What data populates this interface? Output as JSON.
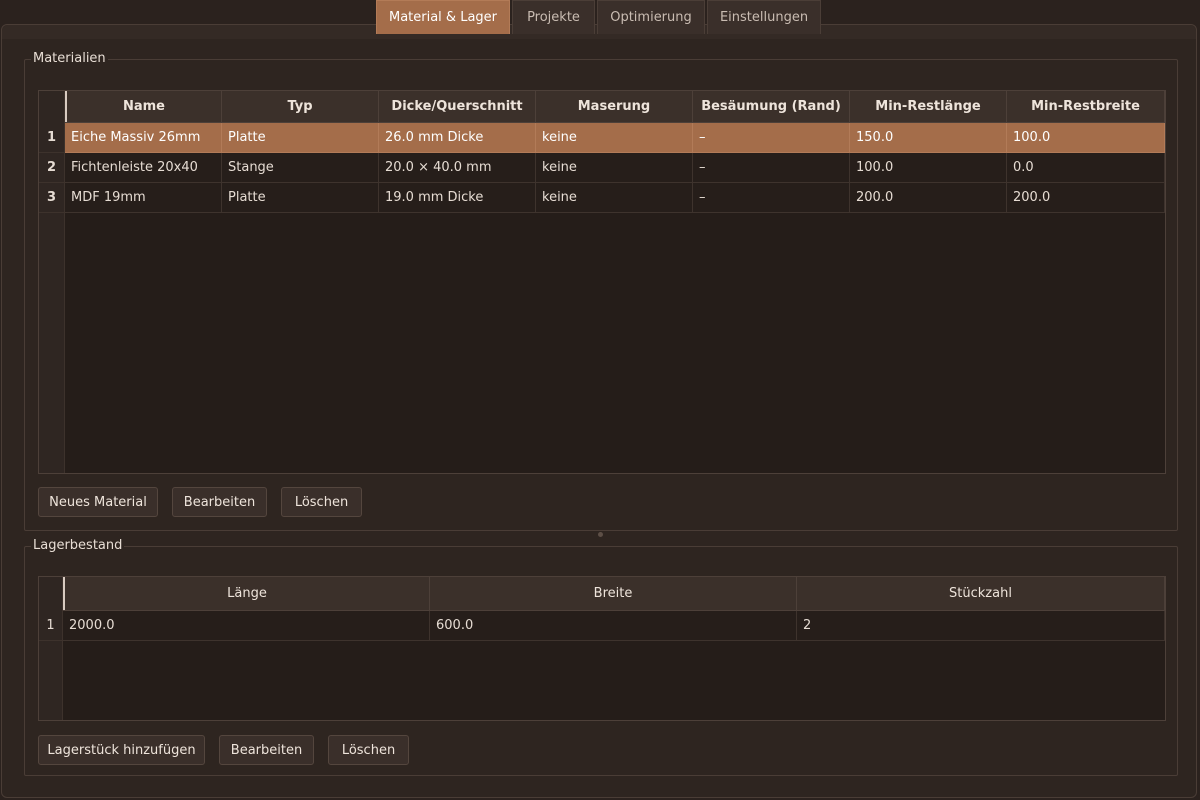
{
  "tabs": [
    {
      "label": "Material & Lager",
      "active": true
    },
    {
      "label": "Projekte",
      "active": false
    },
    {
      "label": "Optimierung",
      "active": false
    },
    {
      "label": "Einstellungen",
      "active": false
    }
  ],
  "materials": {
    "title": "Materialien",
    "columns": [
      "Name",
      "Typ",
      "Dicke/Querschnitt",
      "Maserung",
      "Besäumung (Rand)",
      "Min-Restlänge",
      "Min-Restbreite"
    ],
    "rows": [
      {
        "num": "1",
        "cells": [
          "Eiche Massiv 26mm",
          "Platte",
          "26.0 mm Dicke",
          "keine",
          "–",
          "150.0",
          "100.0"
        ],
        "selected": true
      },
      {
        "num": "2",
        "cells": [
          "Fichtenleiste 20x40",
          "Stange",
          "20.0 × 40.0 mm",
          "keine",
          "–",
          "100.0",
          "0.0"
        ],
        "selected": false
      },
      {
        "num": "3",
        "cells": [
          "MDF 19mm",
          "Platte",
          "19.0 mm Dicke",
          "keine",
          "–",
          "200.0",
          "200.0"
        ],
        "selected": false
      }
    ],
    "buttons": {
      "new": "Neues Material",
      "edit": "Bearbeiten",
      "delete": "Löschen"
    }
  },
  "stock": {
    "title": "Lagerbestand",
    "columns": [
      "Länge",
      "Breite",
      "Stückzahl"
    ],
    "rows": [
      {
        "num": "1",
        "cells": [
          "2000.0",
          "600.0",
          "2"
        ]
      }
    ],
    "buttons": {
      "add": "Lagerstück hinzufügen",
      "edit": "Bearbeiten",
      "delete": "Löschen"
    }
  },
  "colors": {
    "accent": "#a46d4a",
    "background": "#2b221e",
    "panel": "#2e2520",
    "header": "#3b302a"
  }
}
